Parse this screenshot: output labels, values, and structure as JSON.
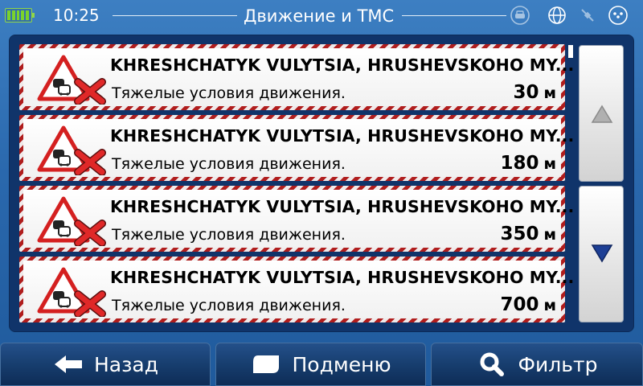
{
  "status_bar": {
    "time": "10:25",
    "title": "Движение и ТМС",
    "icons": [
      "battery-icon",
      "traffic-car-icon",
      "globe-icon",
      "satellite-icon",
      "menu-dots-icon"
    ]
  },
  "traffic_list": {
    "items": [
      {
        "street": "KHRESHCHATYK VULYTSIA, HRUSHEVSKOHO MY...",
        "description": "Тяжелые условия движения.",
        "distance": "30",
        "unit": "м",
        "icon": "traffic-jam-warning-icon"
      },
      {
        "street": "KHRESHCHATYK VULYTSIA, HRUSHEVSKOHO MY...",
        "description": "Тяжелые условия движения.",
        "distance": "180",
        "unit": "м",
        "icon": "traffic-jam-warning-icon"
      },
      {
        "street": "KHRESHCHATYK VULYTSIA, HRUSHEVSKOHO MY...",
        "description": "Тяжелые условия движения.",
        "distance": "350",
        "unit": "м",
        "icon": "traffic-jam-warning-icon"
      },
      {
        "street": "KHRESHCHATYK VULYTSIA, HRUSHEVSKOHO MY...",
        "description": "Тяжелые условия движения.",
        "distance": "700",
        "unit": "м",
        "icon": "traffic-jam-warning-icon"
      }
    ]
  },
  "scroll": {
    "up_icon": "triangle-up-icon",
    "down_icon": "triangle-down-icon"
  },
  "bottom_bar": {
    "back_label": "Назад",
    "submenu_label": "Подменю",
    "filter_label": "Фильтр"
  },
  "colors": {
    "background": "#2a68ad",
    "panel": "#10346a",
    "stripe_red": "#b01d1d",
    "warning_red": "#d42020",
    "scroll_up_arrow": "#a0a0a0",
    "scroll_down_arrow": "#1a3a8c"
  }
}
